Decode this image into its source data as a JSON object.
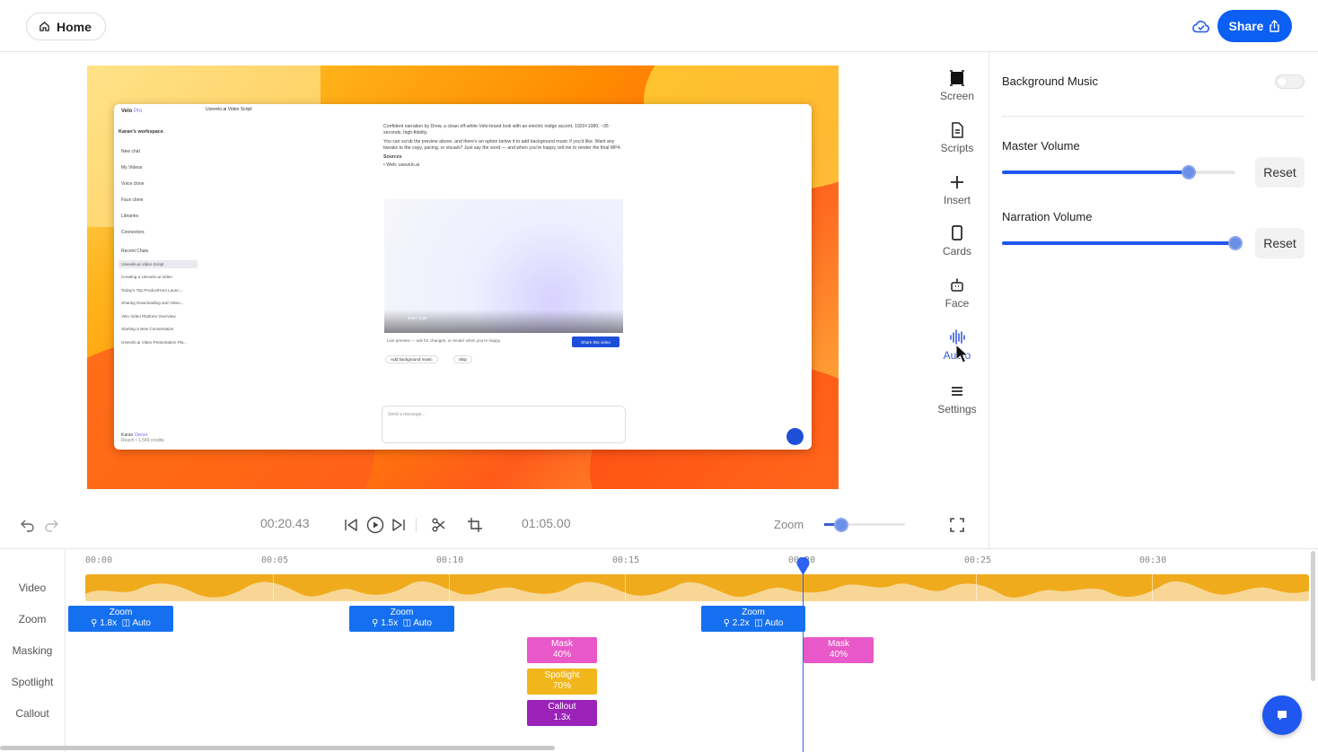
{
  "header": {
    "home_label": "Home",
    "share_label": "Share"
  },
  "preview_window": {
    "app_name": "Velo",
    "badge": "Pro",
    "workspace": "Karan's workspace",
    "nav": [
      "New chat",
      "My Videos",
      "Voice clone",
      "Face clone",
      "Libraries",
      "Connectors"
    ],
    "recent_heading": "Recent Chats",
    "recent": [
      "Usevelo.ai Video Script",
      "Creating a Usevelo.ai Video",
      "Today's Top ProductHunt Launc...",
      "Sharing Downloading and Video...",
      "Velo Video Platform Overview",
      "Starting a New Conversation",
      "Usevelo.ai Video Presentation Pla..."
    ],
    "doc_title": "Usevelo.ai Video Script",
    "para1": "Confident narration by Drew, a clean off-white Velo-brand look with an electric indigo accent, 1920×1080, ~35 seconds, high-fidelity.",
    "para2": "You can scrub the preview above, and there's an option below it to add background music if you'd like. Want any tweaks to the copy, pacing, or visuals? Just say the word — and when you're happy, tell me to render the final MP4.",
    "sources_heading": "Sources",
    "source_item": "Web: usevelo.ai",
    "video_time": "0:00 / 0:38",
    "live_preview": "Live preview — ask for changes, or render when you're happy.",
    "share_video": "Share this video",
    "add_music": "Add background music",
    "skip": "Skip",
    "message_placeholder": "Send a message...",
    "user_name": "Karan",
    "user_plan": "Owner",
    "user_credits": "Reach • 1,549 credits"
  },
  "tools": [
    {
      "label": "Screen",
      "icon": "screen-icon"
    },
    {
      "label": "Scripts",
      "icon": "scripts-icon"
    },
    {
      "label": "Insert",
      "icon": "plus-icon"
    },
    {
      "label": "Cards",
      "icon": "cards-icon"
    },
    {
      "label": "Face",
      "icon": "face-icon"
    },
    {
      "label": "Audio",
      "icon": "audio-icon",
      "active": true
    },
    {
      "label": "Settings",
      "icon": "settings-icon"
    }
  ],
  "audio_panel": {
    "background_music_label": "Background Music",
    "background_music_on": false,
    "master_volume_label": "Master Volume",
    "master_volume": 0.8,
    "narration_volume_label": "Narration Volume",
    "narration_volume": 1.0,
    "reset_label": "Reset"
  },
  "transport": {
    "current_time": "00:20.43",
    "total_time": "01:05.00",
    "zoom_label": "Zoom",
    "zoom_level": 0.2
  },
  "timeline": {
    "track_labels": [
      "Video",
      "Zoom",
      "Masking",
      "Spotlight",
      "Callout"
    ],
    "ticks": [
      "00:00",
      "00:05",
      "00:10",
      "00:15",
      "00:20",
      "00:25",
      "00:30"
    ],
    "zoom_clips": [
      {
        "title": "Zoom",
        "factor": "1.8x",
        "mode": "Auto"
      },
      {
        "title": "Zoom",
        "factor": "1.5x",
        "mode": "Auto"
      },
      {
        "title": "Zoom",
        "factor": "2.2x",
        "mode": "Auto"
      }
    ],
    "mask_clips": [
      {
        "title": "Mask",
        "value": "40%"
      },
      {
        "title": "Mask",
        "value": "40%"
      }
    ],
    "spotlight_clip": {
      "title": "Spotlight",
      "value": "70%"
    },
    "callout_clip": {
      "title": "Callout",
      "value": "1.3x"
    }
  },
  "colors": {
    "accent": "#0b5ff2",
    "video_track": "#f0ab1d",
    "zoom_clip": "#1570ef",
    "mask_clip": "#e858c8",
    "spotlight_clip": "#f2b61d",
    "callout_clip": "#9a22b8"
  }
}
